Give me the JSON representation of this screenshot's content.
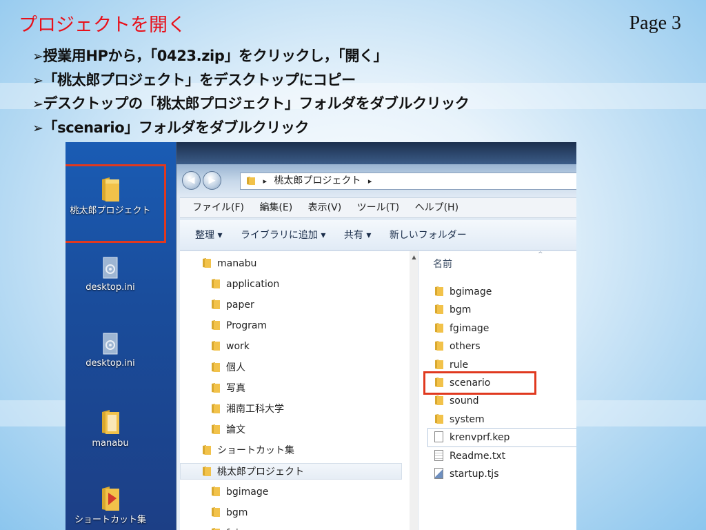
{
  "slide": {
    "title": "プロジェクトを開く",
    "page": "Page 3",
    "bullets": [
      "授業用HPから，「0423.zip」をクリックし，「開く」",
      "「桃太郎プロジェクト」をデスクトップにコピー",
      "デスクトップの「桃太郎プロジェクト」フォルダをダブルクリック",
      "「scenario」フォルダをダブルクリック"
    ],
    "bullet_marker": "➢"
  },
  "desktop": {
    "icons": [
      {
        "label": "桃太郎プロジェクト",
        "icon": "folder-icon"
      },
      {
        "label": "desktop.ini",
        "icon": "settings-file-icon"
      },
      {
        "label": "desktop.ini",
        "icon": "settings-file-icon"
      },
      {
        "label": "manabu",
        "icon": "folder-icon"
      },
      {
        "label": "ショートカット集",
        "icon": "shortcut-folder-icon"
      }
    ]
  },
  "explorer": {
    "breadcrumb_sep": "▸",
    "address": "桃太郎プロジェクト",
    "menu": [
      "ファイル(F)",
      "編集(E)",
      "表示(V)",
      "ツール(T)",
      "ヘルプ(H)"
    ],
    "toolbar": [
      "整理 ▾",
      "ライブラリに追加 ▾",
      "共有 ▾",
      "新しいフォルダー"
    ],
    "column_header": "名前",
    "nav_tree": [
      {
        "label": "manabu",
        "level": 0
      },
      {
        "label": "application",
        "level": 1
      },
      {
        "label": "paper",
        "level": 1
      },
      {
        "label": "Program",
        "level": 1
      },
      {
        "label": "work",
        "level": 1
      },
      {
        "label": "個人",
        "level": 1
      },
      {
        "label": "写真",
        "level": 1
      },
      {
        "label": "湘南工科大学",
        "level": 1
      },
      {
        "label": "論文",
        "level": 1
      },
      {
        "label": "ショートカット集",
        "level": 0
      },
      {
        "label": "桃太郎プロジェクト",
        "level": 0,
        "selected": true
      },
      {
        "label": "bgimage",
        "level": 1
      },
      {
        "label": "bgm",
        "level": 1
      },
      {
        "label": "fgimage",
        "level": 1
      }
    ],
    "files": [
      {
        "name": "bgimage",
        "type": "folder"
      },
      {
        "name": "bgm",
        "type": "folder"
      },
      {
        "name": "fgimage",
        "type": "folder"
      },
      {
        "name": "others",
        "type": "folder"
      },
      {
        "name": "rule",
        "type": "folder"
      },
      {
        "name": "scenario",
        "type": "folder",
        "highlighted": true
      },
      {
        "name": "sound",
        "type": "folder"
      },
      {
        "name": "system",
        "type": "folder"
      },
      {
        "name": "krenvprf.kep",
        "type": "file"
      },
      {
        "name": "Readme.txt",
        "type": "text"
      },
      {
        "name": "startup.tjs",
        "type": "script"
      }
    ]
  },
  "colors": {
    "title": "#e8101a",
    "highlight_box": "#e0391f",
    "folder": "#f2c24a"
  }
}
